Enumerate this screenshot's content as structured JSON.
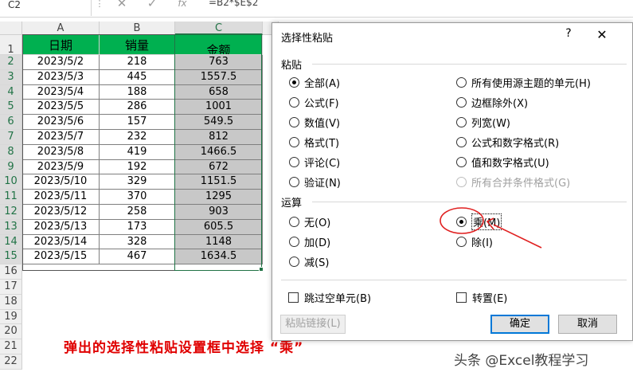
{
  "formula_bar": {
    "name_box": "C2",
    "formula": "=B2*$E$2",
    "cancel_icon": "x-icon",
    "enter_icon": "check-icon",
    "fx_label": "fx"
  },
  "sheet": {
    "columns": [
      "A",
      "B",
      "C"
    ],
    "row_numbers": [
      "1",
      "2",
      "3",
      "4",
      "5",
      "6",
      "7",
      "8",
      "9",
      "10",
      "11",
      "12",
      "13",
      "14",
      "15",
      "16",
      "17",
      "18",
      "19",
      "20",
      "21",
      "22"
    ],
    "headers": [
      "日期",
      "销量",
      "金额"
    ],
    "rows": [
      {
        "date": "2023/5/2",
        "qty": "218",
        "amount": "763"
      },
      {
        "date": "2023/5/3",
        "qty": "445",
        "amount": "1557.5"
      },
      {
        "date": "2023/5/4",
        "qty": "188",
        "amount": "658"
      },
      {
        "date": "2023/5/5",
        "qty": "286",
        "amount": "1001"
      },
      {
        "date": "2023/5/6",
        "qty": "157",
        "amount": "549.5"
      },
      {
        "date": "2023/5/7",
        "qty": "232",
        "amount": "812"
      },
      {
        "date": "2023/5/8",
        "qty": "419",
        "amount": "1466.5"
      },
      {
        "date": "2023/5/9",
        "qty": "192",
        "amount": "672"
      },
      {
        "date": "2023/5/10",
        "qty": "329",
        "amount": "1151.5"
      },
      {
        "date": "2023/5/11",
        "qty": "370",
        "amount": "1295"
      },
      {
        "date": "2023/5/12",
        "qty": "258",
        "amount": "903"
      },
      {
        "date": "2023/5/13",
        "qty": "173",
        "amount": "605.5"
      },
      {
        "date": "2023/5/14",
        "qty": "328",
        "amount": "1148"
      },
      {
        "date": "2023/5/15",
        "qty": "467",
        "amount": "1634.5"
      }
    ],
    "header_color": "#00b050",
    "selected_fill": "#c8c8c8"
  },
  "dialog": {
    "title": "选择性粘贴",
    "help": "?",
    "close": "✕",
    "paste_group": "粘贴",
    "paste_left": [
      {
        "label": "全部(A)",
        "checked": true
      },
      {
        "label": "公式(F)",
        "checked": false
      },
      {
        "label": "数值(V)",
        "checked": false
      },
      {
        "label": "格式(T)",
        "checked": false
      },
      {
        "label": "评论(C)",
        "checked": false
      },
      {
        "label": "验证(N)",
        "checked": false
      }
    ],
    "paste_right": [
      {
        "label": "所有使用源主题的单元(H)",
        "checked": false,
        "disabled": false
      },
      {
        "label": "边框除外(X)",
        "checked": false,
        "disabled": false
      },
      {
        "label": "列宽(W)",
        "checked": false,
        "disabled": false
      },
      {
        "label": "公式和数字格式(R)",
        "checked": false,
        "disabled": false
      },
      {
        "label": "值和数字格式(U)",
        "checked": false,
        "disabled": false
      },
      {
        "label": "所有合并条件格式(G)",
        "checked": false,
        "disabled": true
      }
    ],
    "operation_group": "运算",
    "operation_left": [
      {
        "label": "无(O)",
        "checked": false
      },
      {
        "label": "加(D)",
        "checked": false
      },
      {
        "label": "减(S)",
        "checked": false
      }
    ],
    "operation_right": [
      {
        "label": "乘(M)",
        "checked": true
      },
      {
        "label": "除(I)",
        "checked": false
      }
    ],
    "skip_blanks": "跳过空单元(B)",
    "transpose": "转置(E)",
    "paste_link": "粘贴链接(L)",
    "ok": "确定",
    "cancel": "取消"
  },
  "caption": "弹出的选择性粘贴设置框中选择 “乘”",
  "watermark": "头条 @Excel教程学习",
  "annotation_color": "#e02020"
}
